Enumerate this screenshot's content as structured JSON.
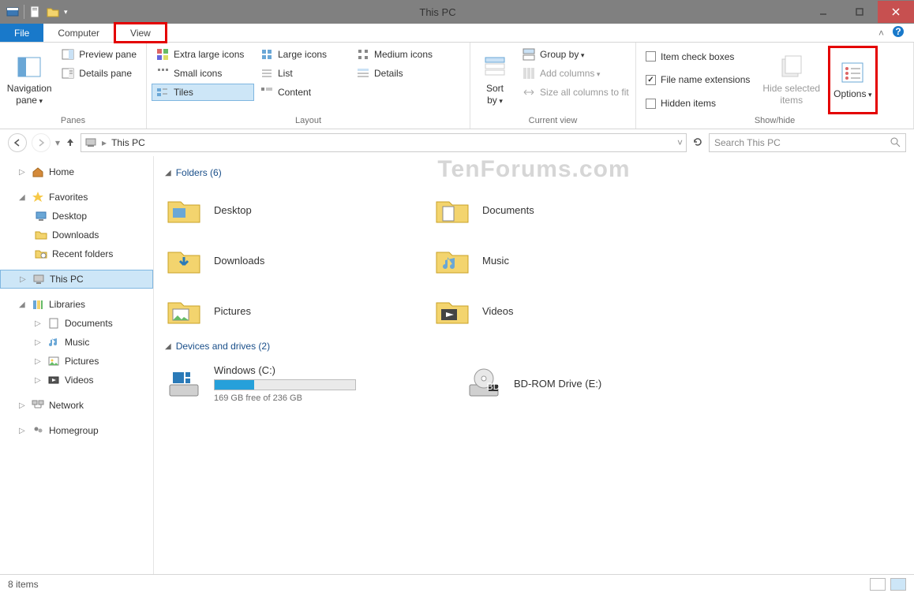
{
  "window": {
    "title": "This PC"
  },
  "tabs": {
    "file": "File",
    "computer": "Computer",
    "view": "View"
  },
  "ribbon": {
    "panes": {
      "label": "Panes",
      "navigation": "Navigation\npane",
      "preview": "Preview pane",
      "details": "Details pane"
    },
    "layout": {
      "label": "Layout",
      "extra_large": "Extra large icons",
      "large": "Large icons",
      "medium": "Medium icons",
      "small": "Small icons",
      "list": "List",
      "details_view": "Details",
      "tiles": "Tiles",
      "content_view": "Content"
    },
    "current_view": {
      "label": "Current view",
      "sort_by": "Sort\nby",
      "group_by": "Group by",
      "add_columns": "Add columns",
      "size_all": "Size all columns to fit"
    },
    "show_hide": {
      "label": "Show/hide",
      "check_boxes": "Item check boxes",
      "extensions": "File name extensions",
      "hidden": "Hidden items",
      "hide_selected": "Hide selected\nitems",
      "options": "Options"
    }
  },
  "addressbar": {
    "path": "This PC"
  },
  "search": {
    "placeholder": "Search This PC"
  },
  "tree": {
    "home": "Home",
    "favorites": "Favorites",
    "fav_desktop": "Desktop",
    "fav_downloads": "Downloads",
    "fav_recent": "Recent folders",
    "thispc": "This PC",
    "libraries": "Libraries",
    "lib_documents": "Documents",
    "lib_music": "Music",
    "lib_pictures": "Pictures",
    "lib_videos": "Videos",
    "network": "Network",
    "homegroup": "Homegroup"
  },
  "content": {
    "folders_header": "Folders (6)",
    "devices_header": "Devices and drives (2)",
    "folders": {
      "desktop": "Desktop",
      "documents": "Documents",
      "downloads": "Downloads",
      "music": "Music",
      "pictures": "Pictures",
      "videos": "Videos"
    },
    "drives": {
      "windows_label": "Windows (C:)",
      "windows_sub": "169 GB free of 236 GB",
      "windows_fill_pct": 28,
      "bdrom_label": "BD-ROM Drive (E:)"
    }
  },
  "status": {
    "items": "8 items"
  },
  "watermark": "TenForums.com"
}
